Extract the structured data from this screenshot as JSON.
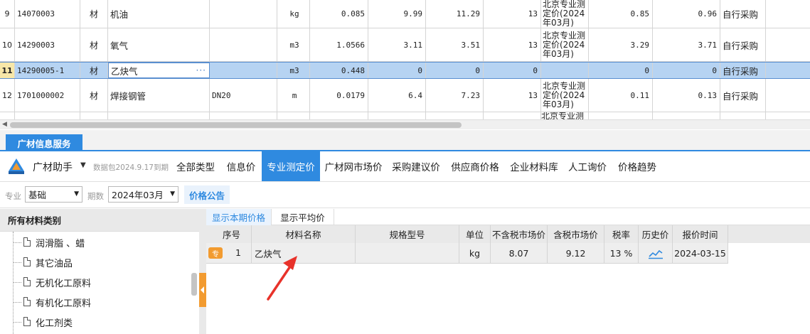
{
  "grid": {
    "rows": [
      {
        "idx": "9",
        "code": "14070003",
        "type": "材",
        "name": "机油",
        "spec": "",
        "unit": "kg",
        "qty": "0.085",
        "p1": "9.99",
        "p2": "11.29",
        "tax": "13",
        "src": "北京专业测定价(2024年03月)",
        "v1": "0.85",
        "v2": "0.96",
        "buy": "自行采购"
      },
      {
        "idx": "10",
        "code": "14290003",
        "type": "材",
        "name": "氧气",
        "spec": "",
        "unit": "m3",
        "qty": "1.0566",
        "p1": "3.11",
        "p2": "3.51",
        "tax": "13",
        "src": "北京专业测定价(2024年03月)",
        "v1": "3.29",
        "v2": "3.71",
        "buy": "自行采购"
      },
      {
        "idx": "11",
        "code": "14290005-1",
        "type": "材",
        "name": "乙炔气",
        "spec": "",
        "unit": "m3",
        "qty": "0.448",
        "p1": "0",
        "p2": "0",
        "tax": "0",
        "src": "",
        "v1": "0",
        "v2": "0",
        "buy": "自行采购",
        "edit_dots": "···"
      },
      {
        "idx": "12",
        "code": "1701000002",
        "type": "材",
        "name": "焊接钢管",
        "spec": "DN20",
        "unit": "m",
        "qty": "0.0179",
        "p1": "6.4",
        "p2": "7.23",
        "tax": "13",
        "src": "北京专业测定价(2024年03月)",
        "v1": "0.11",
        "v2": "0.13",
        "buy": "自行采购"
      },
      {
        "idx": "",
        "code": "",
        "type": "",
        "name": "",
        "spec": "",
        "unit": "",
        "qty": "",
        "p1": "",
        "p2": "",
        "tax": "",
        "src": "北京专业测",
        "v1": "",
        "v2": "",
        "buy": ""
      }
    ]
  },
  "service_tab": "广材信息服务",
  "toolbar": {
    "assistant": "广材助手",
    "caret": "▼",
    "datapack": "数据包2024.9.17到期",
    "tabs": [
      "全部类型",
      "信息价",
      "专业测定价",
      "广材网市场价",
      "采购建议价",
      "供应商价格",
      "企业材料库",
      "人工询价",
      "价格趋势"
    ],
    "active_tab": 2
  },
  "filters": {
    "major_label": "专业",
    "major_value": "基础",
    "period_label": "期数",
    "period_value": "2024年03月",
    "notice": "价格公告"
  },
  "tree": {
    "header": "所有材料类别",
    "items": [
      "润滑脂 、蜡",
      "其它油品",
      "无机化工原料",
      "有机化工原料",
      "化工剂类"
    ]
  },
  "subtabs": [
    "显示本期价格",
    "显示平均价"
  ],
  "price_table": {
    "headers": [
      "序号",
      "材料名称",
      "规格型号",
      "单位",
      "不含税市场价",
      "含税市场价",
      "税率",
      "历史价",
      "报价时间"
    ],
    "rows": [
      {
        "badge": "专",
        "idx": "1",
        "name": "乙炔气",
        "spec": "",
        "unit": "kg",
        "price_ex": "8.07",
        "price_in": "9.12",
        "tax": "13 %",
        "history": "chart-line-icon",
        "time": "2024-03-15"
      }
    ]
  },
  "colors": {
    "accent": "#2f8ae0",
    "selected_row": "#b6d3f2",
    "badge": "#f29b30",
    "arrow": "#e8322a"
  }
}
